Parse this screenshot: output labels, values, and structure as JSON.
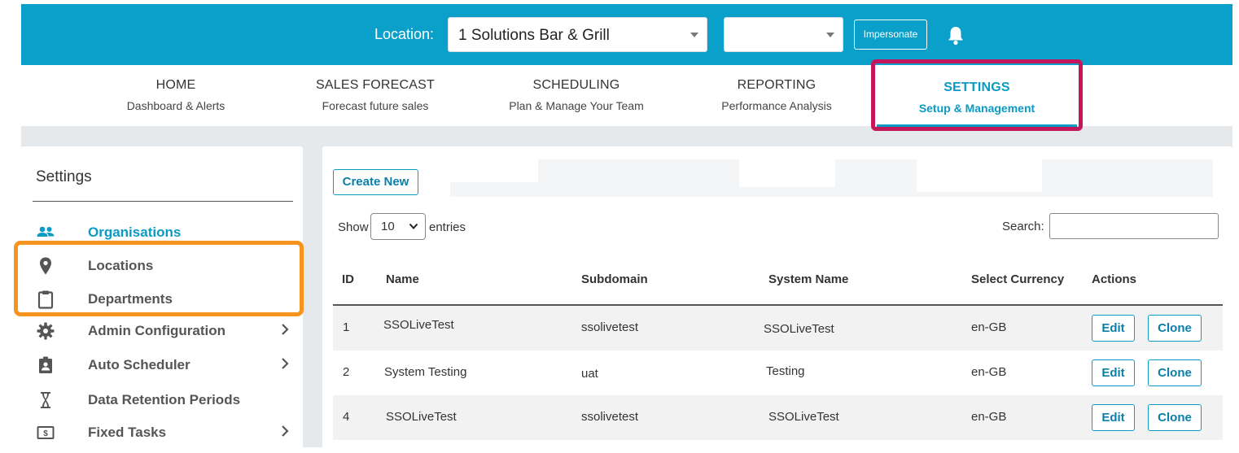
{
  "header": {
    "location_label": "Location:",
    "location_value": "1 Solutions Bar & Grill",
    "secondary_value": "",
    "impersonate_label": "Impersonate",
    "bell_icon": "bell-icon"
  },
  "nav": {
    "items": [
      {
        "title": "HOME",
        "subtitle": "Dashboard & Alerts"
      },
      {
        "title": "SALES FORECAST",
        "subtitle": "Forecast future sales"
      },
      {
        "title": "SCHEDULING",
        "subtitle": "Plan & Manage Your Team"
      },
      {
        "title": "REPORTING",
        "subtitle": "Performance Analysis"
      },
      {
        "title": "SETTINGS",
        "subtitle": "Setup & Management"
      }
    ],
    "active_color": "#0a9bc4"
  },
  "sidebar": {
    "title": "Settings",
    "items": [
      {
        "label": "Organisations",
        "icon": "people-icon",
        "has_submenu": false,
        "active": true
      },
      {
        "label": "Locations",
        "icon": "location-pin-icon",
        "has_submenu": false,
        "active": false
      },
      {
        "label": "Departments",
        "icon": "clipboard-icon",
        "has_submenu": false,
        "active": false
      },
      {
        "label": "Admin Configuration",
        "icon": "gear-icon",
        "has_submenu": true,
        "active": false
      },
      {
        "label": "Auto Scheduler",
        "icon": "badge-icon",
        "has_submenu": true,
        "active": false
      },
      {
        "label": "Data Retention Periods",
        "icon": "hourglass-icon",
        "has_submenu": false,
        "active": false
      },
      {
        "label": "Fixed Tasks",
        "icon": "money-icon",
        "has_submenu": true,
        "active": false
      }
    ]
  },
  "main": {
    "create_new_label": "Create New",
    "show_label": "Show",
    "entries_value": "10",
    "entries_label": "entries",
    "search_label": "Search:",
    "search_value": "",
    "table": {
      "columns": [
        "ID",
        "Name",
        "Subdomain",
        "System Name",
        "Select Currency",
        "Actions"
      ],
      "rows": [
        {
          "id": "1",
          "name": "SSOLiveTest",
          "subdomain": "ssolivetest",
          "system_name": "SSOLiveTest",
          "currency": "en-GB"
        },
        {
          "id": "2",
          "name": "System Testing",
          "subdomain": "uat",
          "system_name": "Testing",
          "currency": "en-GB"
        },
        {
          "id": "4",
          "name": "SSOLiveTest",
          "subdomain": "ssolivetest",
          "system_name": "SSOLiveTest",
          "currency": "en-GB"
        }
      ],
      "edit_label": "Edit",
      "clone_label": "Clone"
    }
  },
  "colors": {
    "brand": "#0aa0c9",
    "settings_highlight": "#c2185b",
    "sidebar_highlight": "#f7941d"
  }
}
